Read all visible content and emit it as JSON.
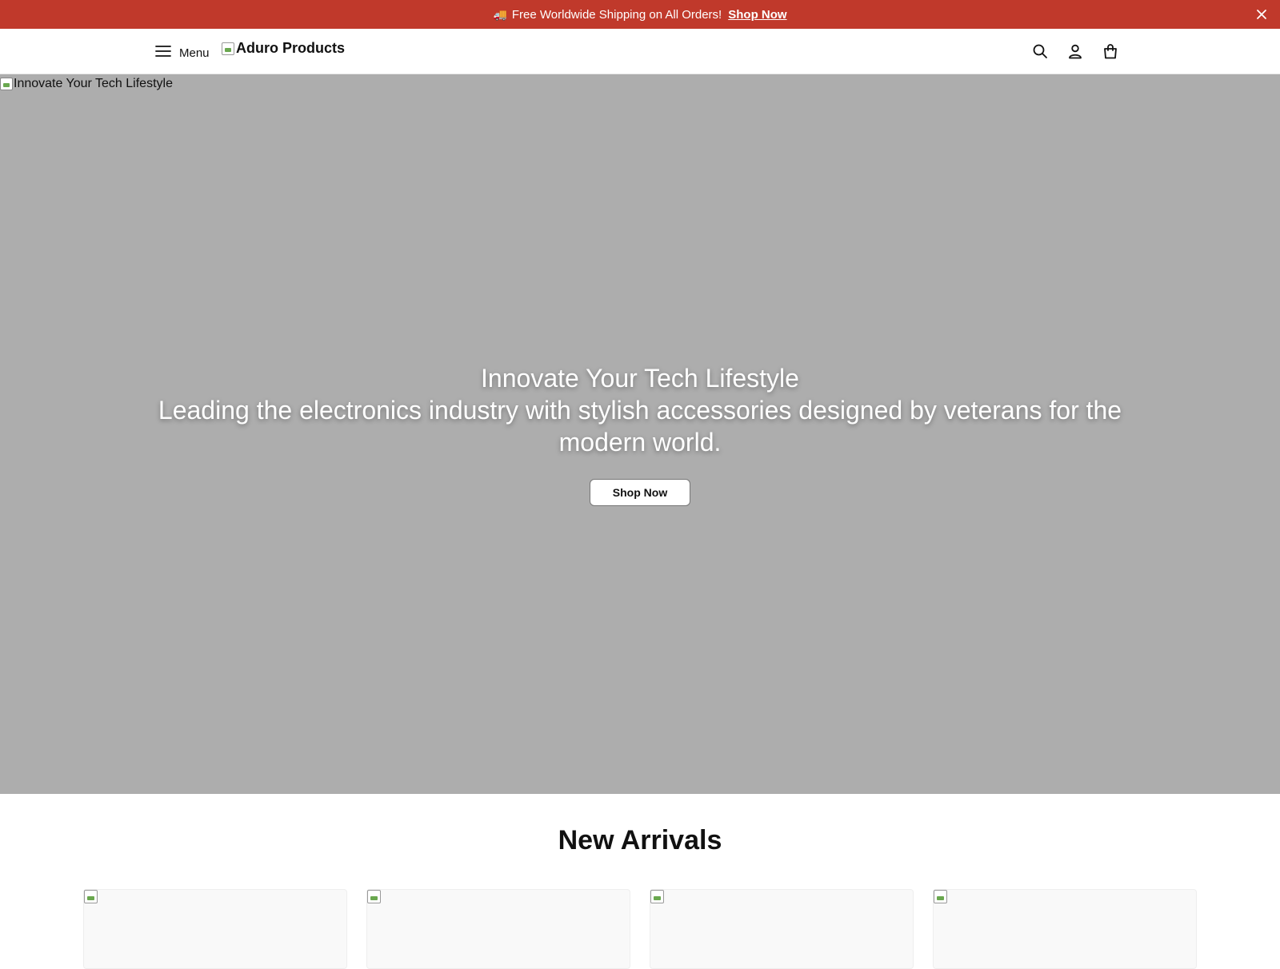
{
  "announcement": {
    "icon": "truck-icon",
    "text": "Free Worldwide Shipping on All Orders!",
    "link_label": "Shop Now",
    "background": "#c0392b"
  },
  "header": {
    "menu_label": "Menu",
    "logo_alt": "Aduro Products",
    "icons": [
      "search-icon",
      "account-icon",
      "cart-icon"
    ]
  },
  "hero": {
    "image_alt": "Innovate Your Tech Lifestyle",
    "title": "Innovate Your Tech Lifestyle",
    "subtitle": "Leading the electronics industry with stylish accessories designed by veterans for the modern world.",
    "cta_label": "Shop Now"
  },
  "arrivals": {
    "title": "New Arrivals",
    "cards": [
      {
        "name": "product-card-1"
      },
      {
        "name": "product-card-2"
      },
      {
        "name": "product-card-3"
      },
      {
        "name": "product-card-4"
      }
    ]
  }
}
